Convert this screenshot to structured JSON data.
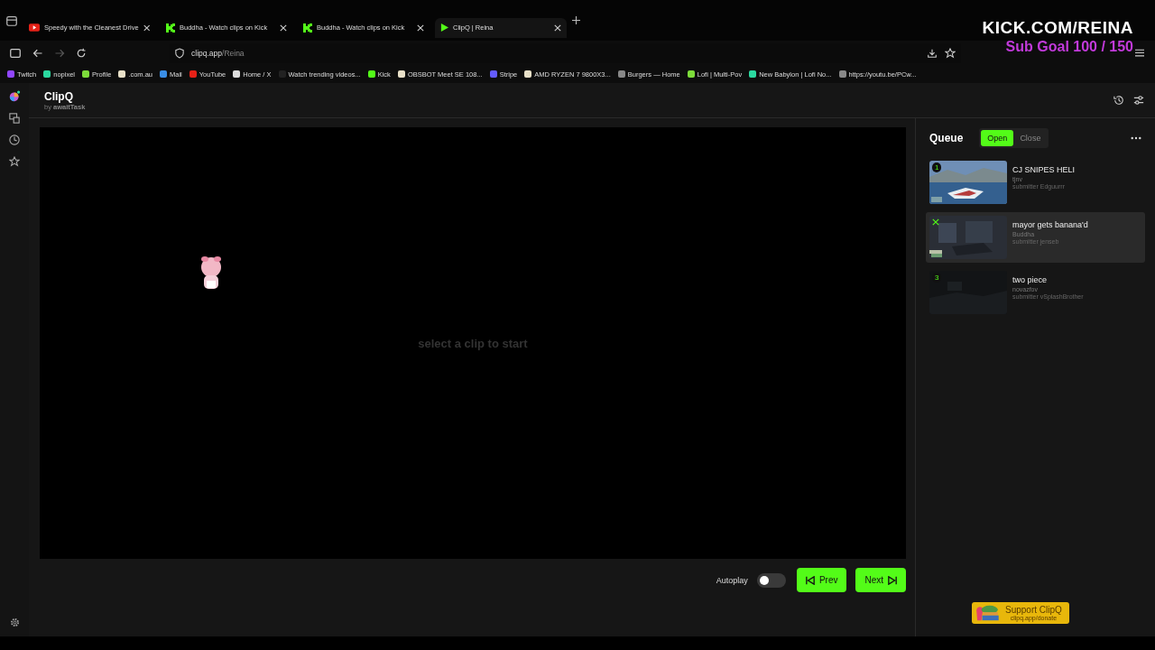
{
  "browser": {
    "tabs": [
      {
        "title": "Speedy with the Cleanest Drive",
        "kind": "video",
        "selected": false
      },
      {
        "title": "Buddha - Watch clips on Kick",
        "kind": "kick",
        "selected": false
      },
      {
        "title": "Buddha - Watch clips on Kick",
        "kind": "kick",
        "selected": false
      },
      {
        "title": "ClipQ | Reina",
        "kind": "app",
        "selected": true
      }
    ],
    "address": {
      "host": "clipq.app",
      "path": "/Reina"
    },
    "bookmarks": [
      {
        "label": "Twitch",
        "color": "#9146ff"
      },
      {
        "label": "nopixel",
        "color": "#2bd9a0"
      },
      {
        "label": "Profile",
        "color": "#7ddc3a"
      },
      {
        "label": ".com.au",
        "color": "#e8e0c8"
      },
      {
        "label": "Mail",
        "color": "#3a8ee6"
      },
      {
        "label": "YouTube",
        "color": "#e62117"
      },
      {
        "label": "Home / X",
        "color": "#dddddd"
      },
      {
        "label": "Watch trending videos...",
        "color": "#222222"
      },
      {
        "label": "Kick",
        "color": "#53fc18"
      },
      {
        "label": "OBSBOT Meet SE 108...",
        "color": "#e8e0c8"
      },
      {
        "label": "Stripe",
        "color": "#635bff"
      },
      {
        "label": "AMD RYZEN 7 9800X3...",
        "color": "#e8e0c8"
      },
      {
        "label": "Burgers — Home",
        "color": "#888888"
      },
      {
        "label": "Lofi | Multi-Pov",
        "color": "#7ddc3a"
      },
      {
        "label": "New Babylon | Lofi No...",
        "color": "#2bd9a0"
      },
      {
        "label": "https://youtu.be/PCw...",
        "color": "#888888"
      }
    ]
  },
  "overlay": {
    "channel": "KICK.COM/REINA",
    "goal": "Sub Goal 100 / 150"
  },
  "app": {
    "title": "ClipQ",
    "byline": "by",
    "author": "awaitTask"
  },
  "player": {
    "message": "select a clip to start"
  },
  "controls": {
    "autoplay_label": "Autoplay",
    "autoplay_on": false,
    "prev": "Prev",
    "next": "Next"
  },
  "queue": {
    "title": "Queue",
    "modes": [
      {
        "label": "Open",
        "selected": true
      },
      {
        "label": "Close",
        "selected": false
      }
    ],
    "items": [
      {
        "number": "1",
        "title": "CJ SNIPES HELI",
        "channel": "tjnv",
        "submitter": "submitter Edguurrr",
        "selected": false
      },
      {
        "title": "mayor gets banana'd",
        "channel": "Buddha",
        "submitter": "submitter jenseb",
        "selected": true
      },
      {
        "number": "3",
        "title": "two piece",
        "channel": "novazfov",
        "submitter": "submitter vSplashBrother",
        "selected": false
      }
    ]
  },
  "support": {
    "title": "Support ClipQ",
    "url": "clipq.app/donate"
  }
}
